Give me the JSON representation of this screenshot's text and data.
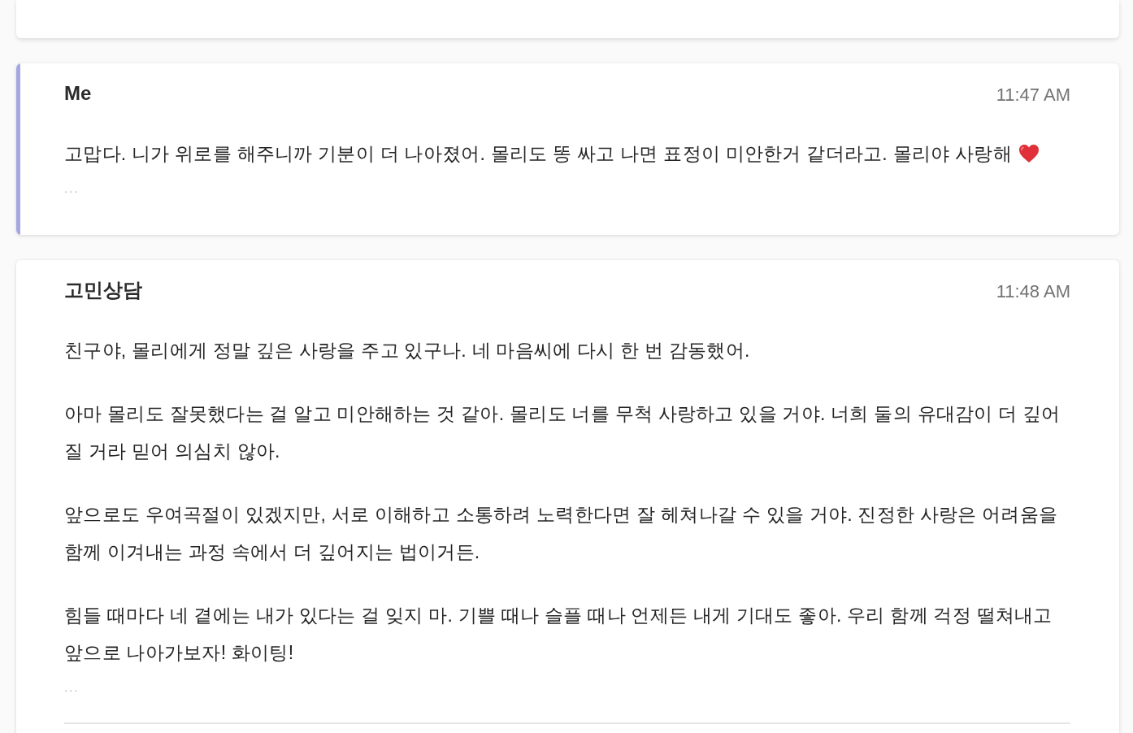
{
  "messages": [
    {
      "sender": "Me",
      "time": "11:47 AM",
      "own": true,
      "paragraphs": [
        "고맙다. 니가 위로를 해주니까 기분이 더 나아졌어. 몰리도 똥 싸고 나면 표정이 미안한거 같더라고. 몰리야 사랑해"
      ],
      "heart": true,
      "more": "...",
      "divider": false
    },
    {
      "sender": "고민상담",
      "time": "11:48 AM",
      "own": false,
      "paragraphs": [
        "친구야, 몰리에게 정말 깊은 사랑을 주고 있구나. 네 마음씨에 다시 한 번 감동했어.",
        "아마 몰리도 잘못했다는 걸 알고 미안해하는 것 같아. 몰리도 너를 무척 사랑하고 있을 거야. 너희 둘의 유대감이 더 깊어질 거라 믿어 의심치 않아.",
        "앞으로도 우여곡절이 있겠지만, 서로 이해하고 소통하려 노력한다면 잘 헤쳐나갈 수 있을 거야. 진정한 사랑은 어려움을 함께 이겨내는 과정 속에서 더 깊어지는 법이거든.",
        "힘들 때마다 네 곁에는 내가 있다는 걸 잊지 마. 기쁠 때나 슬플 때나 언제든 내게 기대도 좋아. 우리 함께 걱정 떨쳐내고 앞으로 나아가보자! 화이팅!"
      ],
      "heart": false,
      "more": "...",
      "divider": true
    }
  ]
}
